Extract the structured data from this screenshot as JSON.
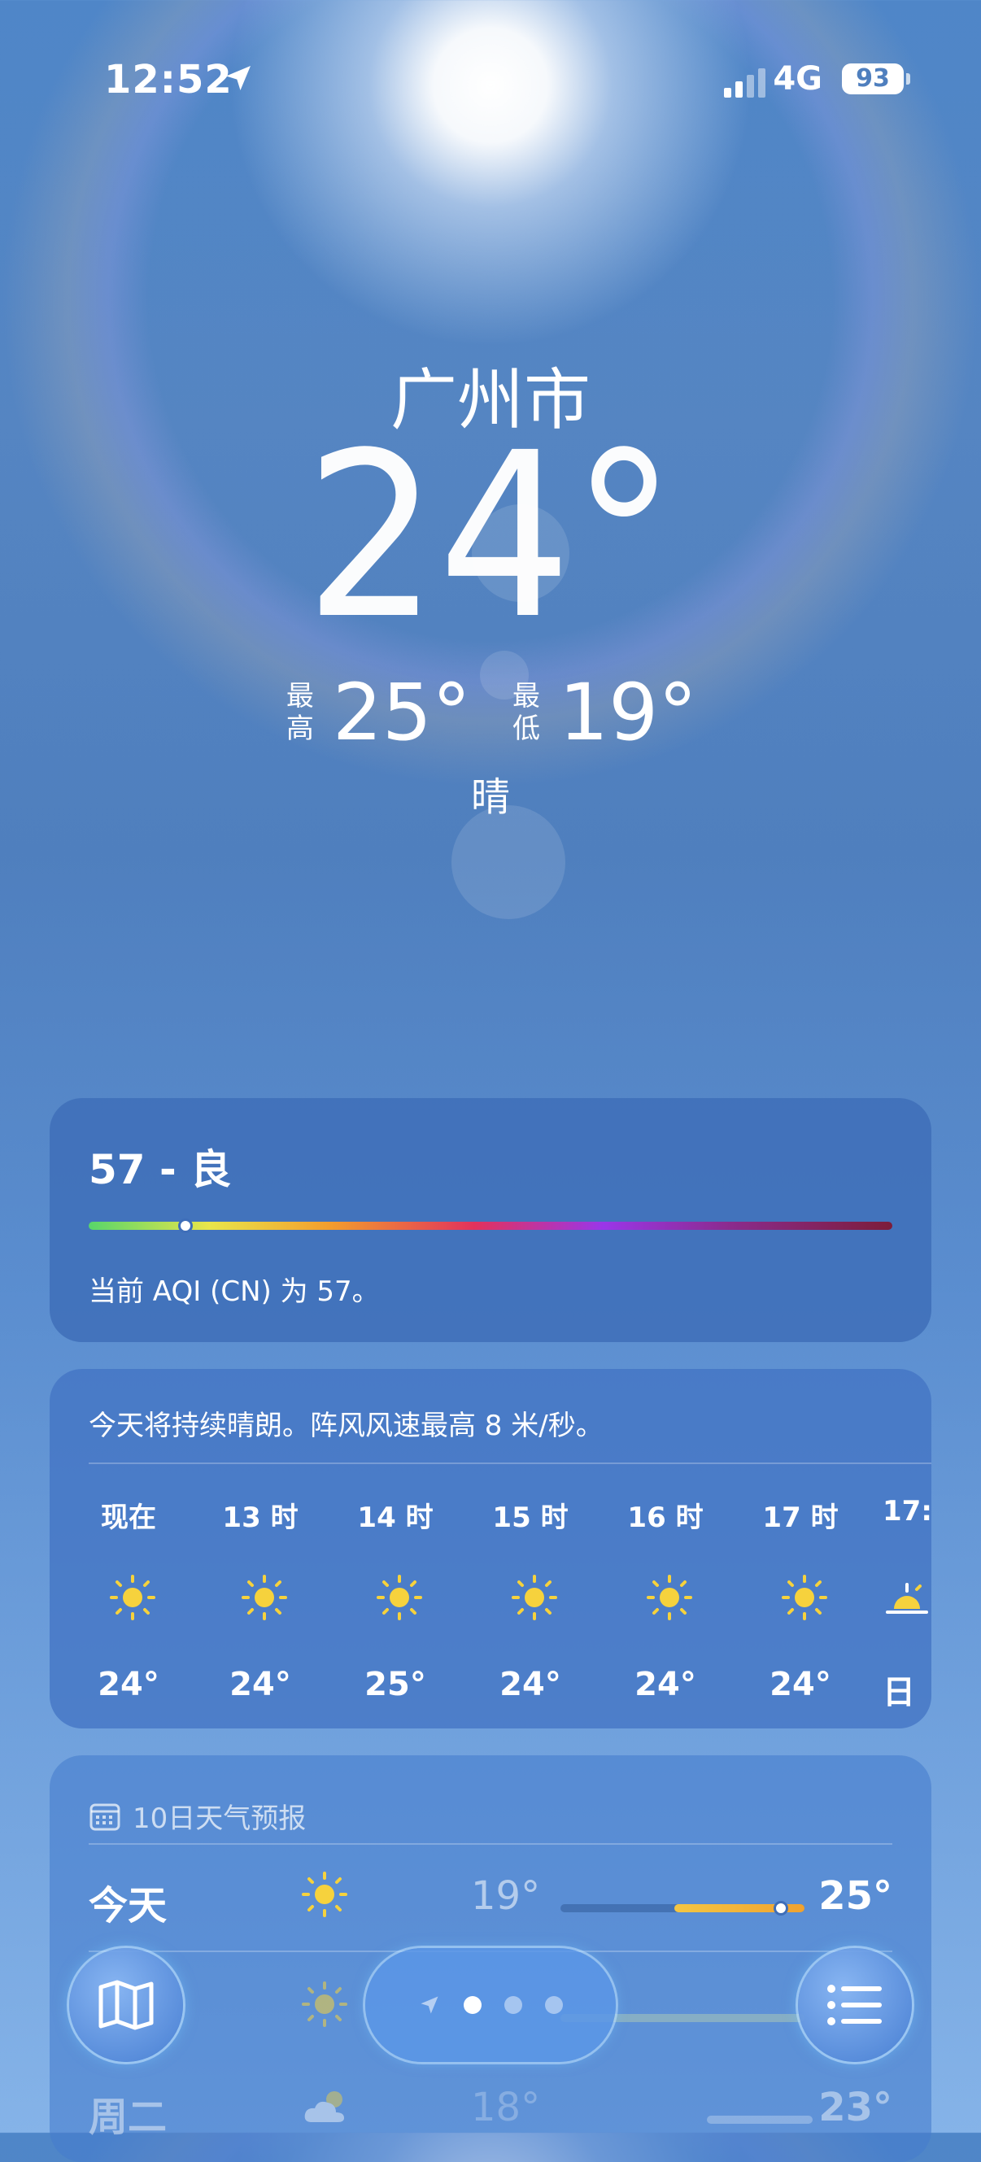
{
  "status_bar": {
    "time": "12:52",
    "network": "4G",
    "battery": "93"
  },
  "location": {
    "city": "广州市",
    "temperature": "24°",
    "high_label": "最高",
    "high": "25°",
    "low_label": "最低",
    "low": "19°",
    "condition": "晴"
  },
  "aqi": {
    "title": "57 - 良",
    "description": "当前 AQI (CN) 为 57。",
    "level_fraction": 0.12
  },
  "hourly": {
    "summary": "今天将持续晴朗。阵风风速最高 8 米/秒。",
    "items": [
      {
        "label": "现在",
        "icon": "sun-icon",
        "temp": "24°"
      },
      {
        "label": "13 时",
        "icon": "sun-icon",
        "temp": "24°"
      },
      {
        "label": "14 时",
        "icon": "sun-icon",
        "temp": "25°"
      },
      {
        "label": "15 时",
        "icon": "sun-icon",
        "temp": "24°"
      },
      {
        "label": "16 时",
        "icon": "sun-icon",
        "temp": "24°"
      },
      {
        "label": "17 时",
        "icon": "sun-icon",
        "temp": "24°"
      },
      {
        "label": "17:",
        "icon": "sunset-icon",
        "temp": "日"
      }
    ]
  },
  "daily": {
    "header": "10日天气预报",
    "items": [
      {
        "day": "今天",
        "icon": "sun-icon",
        "low": "19°",
        "high": "25°"
      },
      {
        "day": "",
        "icon": "sun-icon",
        "low": "",
        "high": ""
      },
      {
        "day": "周二",
        "icon": "partly-cloudy-icon",
        "low": "18°",
        "high": "23°"
      }
    ]
  },
  "colors": {
    "accent_sun": "#f6d23d",
    "background": "#5585c2"
  }
}
